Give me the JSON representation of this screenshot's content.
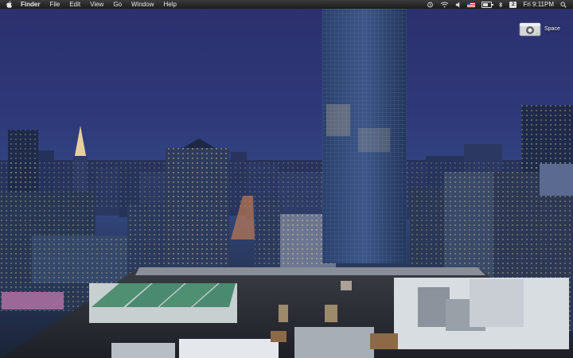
{
  "menubar": {
    "app_name": "Finder",
    "items": [
      {
        "label": "File"
      },
      {
        "label": "Edit"
      },
      {
        "label": "View"
      },
      {
        "label": "Go"
      },
      {
        "label": "Window"
      },
      {
        "label": "Help"
      }
    ],
    "status": {
      "clock": "Fri 9:11PM",
      "user_initial": "2"
    }
  },
  "desktop_icons": [
    {
      "label": "Space",
      "icon": "external-drive-icon"
    }
  ],
  "colors": {
    "menubar": "#222222",
    "sky_top": "#2b2f6e",
    "sky_horizon": "#344b86"
  }
}
